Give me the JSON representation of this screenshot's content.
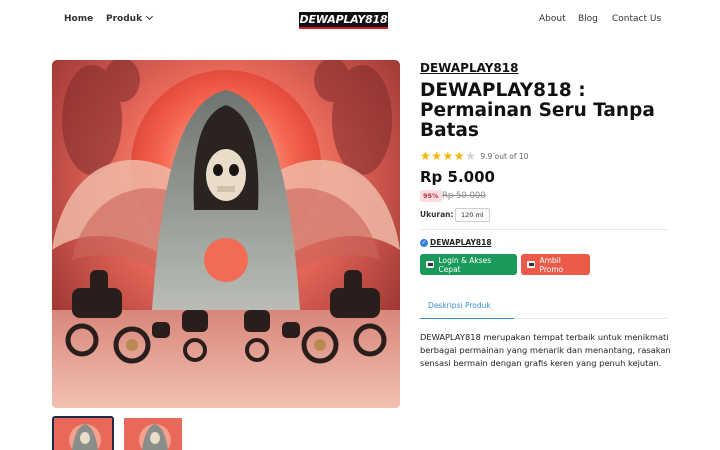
{
  "header": {
    "nav_left": [
      {
        "label": "Home"
      },
      {
        "label": "Produk"
      }
    ],
    "logo": "DEWAPLAY818",
    "nav_right": [
      {
        "label": "About"
      },
      {
        "label": "Blog"
      },
      {
        "label": "Contact Us"
      }
    ]
  },
  "product": {
    "brand": "DEWAPLAY818",
    "title": "DEWAPLAY818 : Permainan Seru Tanpa Batas",
    "rating": 4,
    "rating_max": 5,
    "rating_text": "9.9 out of 10",
    "price": "Rp 5.000",
    "discount": "95%",
    "old_price": "Rp 50.000",
    "size_label": "Ukuran:",
    "size_value": "120 ml",
    "seller": "DEWAPLAY818",
    "buttons": {
      "login": "Login & Akses Cepat",
      "promo": "Ambil Promo"
    },
    "tab": "Deskripsi Produk",
    "description": "DEWAPLAY818 merupakan tempat terbaik untuk menikmati berbagai permainan yang menarik dan menantang, rasakan sensasi bermain dengan grafis keren yang penuh kejutan."
  },
  "colors": {
    "accent_green": "#1a9a5a",
    "accent_red": "#ec5b4a",
    "tab_blue": "#3b8fcf",
    "star": "#f2b600"
  }
}
